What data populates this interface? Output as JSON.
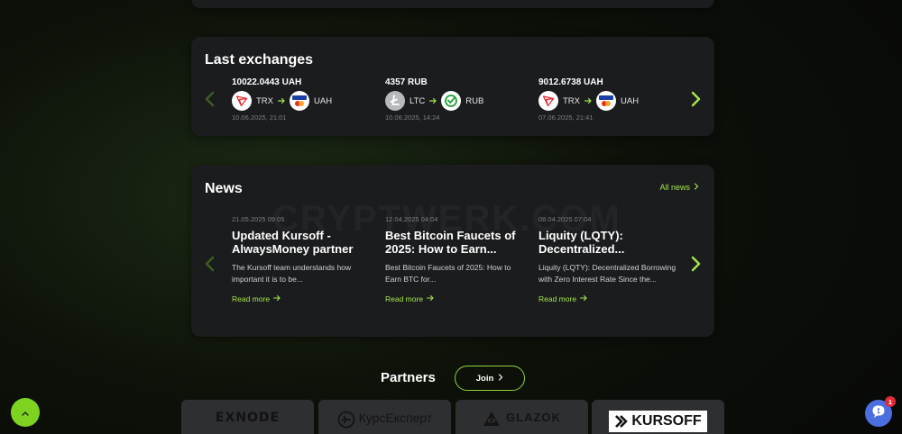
{
  "exchanges": {
    "title": "Last exchanges",
    "items": [
      {
        "amount": "10022.0443 UAH",
        "from": "TRX",
        "to": "UAH",
        "from_icon": "tron-icon",
        "to_icon": "visa-mastercard-icon",
        "date": "10.06.2025, 21:01"
      },
      {
        "amount": "4357 RUB",
        "from": "LTC",
        "to": "RUB",
        "from_icon": "litecoin-icon",
        "to_icon": "sber-icon",
        "date": "10.06.2025, 14:24"
      },
      {
        "amount": "9012.6738 UAH",
        "from": "TRX",
        "to": "UAH",
        "from_icon": "tron-icon",
        "to_icon": "visa-mastercard-icon",
        "date": "07.06.2025, 21:41"
      }
    ]
  },
  "news": {
    "title": "News",
    "all_label": "All news",
    "watermark": "CRYPTWERK.COM",
    "read_more": "Read more",
    "items": [
      {
        "date": "21.05.2025 09:05",
        "title": "Updated Kursoff - AlwaysMoney partner",
        "text": "The Kursoff team understands how important it is to be..."
      },
      {
        "date": "12.04.2025 04:04",
        "title": "Best Bitcoin Faucets of 2025: How to Earn...",
        "text": "Best Bitcoin Faucets of 2025: How to Earn BTC for..."
      },
      {
        "date": "08.04.2025 07:04",
        "title": "Liquity (LQTY): Decentralized...",
        "text": "Liquity (LQTY): Decentralized Borrowing with Zero Interest Rate Since the..."
      }
    ]
  },
  "partners": {
    "title": "Partners",
    "join_label": "Join",
    "items": [
      {
        "name": "EXNODE"
      },
      {
        "name": "КурсЕксперт"
      },
      {
        "name": "GLAZOK"
      },
      {
        "name": "KURSOFF"
      }
    ]
  },
  "chat": {
    "badge": "1"
  },
  "colors": {
    "accent": "#8ed23a",
    "card": "#1b1c1e",
    "chat": "#4b6fe0",
    "badge": "#e02a36"
  }
}
